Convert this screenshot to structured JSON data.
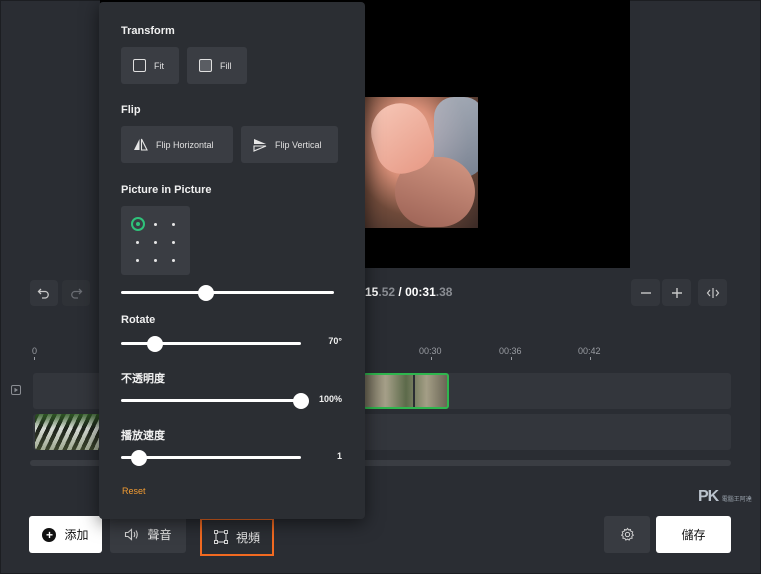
{
  "player": {
    "time_current_main": "15",
    "time_current_frac": ".52",
    "time_separator": " / ",
    "time_total_main": "00:31",
    "time_total_frac": ".38"
  },
  "ruler": {
    "start": "0",
    "labels": [
      "00:30",
      "00:36",
      "00:42"
    ]
  },
  "panel": {
    "transform": {
      "title": "Transform",
      "fit_label": "Fit",
      "fill_label": "Fill"
    },
    "flip": {
      "title": "Flip",
      "horizontal_label": "Flip Horizontal",
      "vertical_label": "Flip Vertical"
    },
    "pip": {
      "title": "Picture in Picture",
      "selected_position": "top-left",
      "level": 0.4
    },
    "rotate": {
      "title": "Rotate",
      "value": "70°",
      "level": 0.19
    },
    "opacity": {
      "title": "不透明度",
      "value": "100%",
      "level": 1.0
    },
    "speed": {
      "title": "播放速度",
      "value": "1",
      "level": 0.1
    },
    "reset_label": "Reset"
  },
  "bottom_bar": {
    "add_label": "添加",
    "audio_label": "聲音",
    "video_label": "視頻",
    "save_label": "儲存"
  },
  "watermark": {
    "logo": "PK",
    "small": "電腦王阿達"
  },
  "colors": {
    "accent_green": "#2fc27a",
    "highlight_orange": "#f26a21",
    "reset_orange": "#f39c32",
    "clip_selected": "#2fb64e"
  }
}
